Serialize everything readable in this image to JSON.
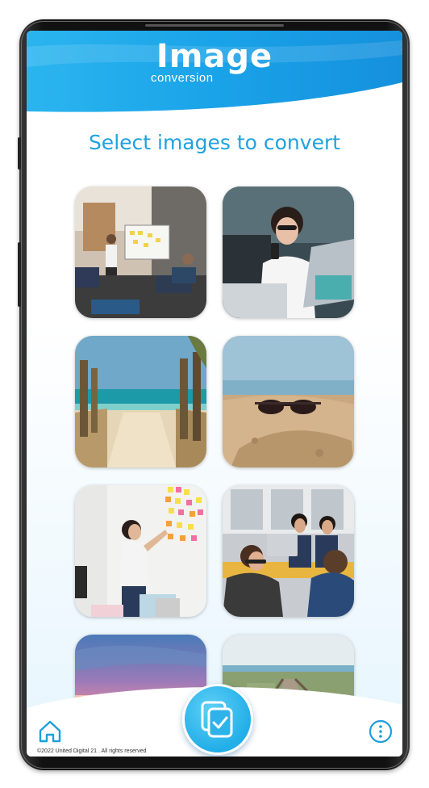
{
  "app": {
    "logo_title": "Image",
    "logo_subtitle": "conversion"
  },
  "main": {
    "heading": "Select images to convert",
    "images": [
      {
        "name": "office-team-meeting"
      },
      {
        "name": "woman-with-phone-laptop"
      },
      {
        "name": "beach-path-sea"
      },
      {
        "name": "sunglasses-on-sand"
      },
      {
        "name": "woman-sticky-notes"
      },
      {
        "name": "team-at-laptops"
      },
      {
        "name": "sunset-sea"
      },
      {
        "name": "boardwalk-dunes"
      }
    ]
  },
  "footer": {
    "copyright": "©2022 United Digital 21 . All rights reserved",
    "home_icon": "home-icon",
    "menu_icon": "more-vertical-icon",
    "convert_icon": "convert-copy-check-icon"
  },
  "colors": {
    "accent": "#1fa2de",
    "header_blue": "#1aa3e8",
    "button_blue": "#22aee8"
  }
}
